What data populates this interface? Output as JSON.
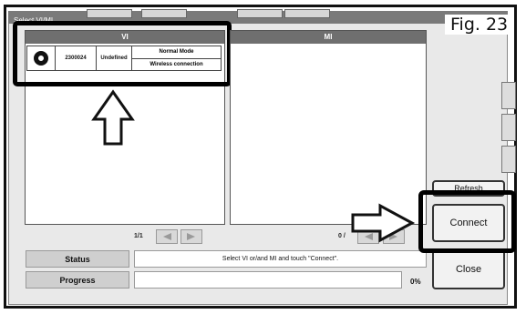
{
  "figure_label": "Fig. 23",
  "window": {
    "title": "Select VI/MI"
  },
  "vi_panel": {
    "header": "VI",
    "device": {
      "serial": "2300024",
      "type": "Undefined",
      "mode": "Normal Mode",
      "connection": "Wireless connection"
    },
    "pager": "1/1"
  },
  "mi_panel": {
    "header": "MI",
    "pager": "0 /"
  },
  "status": {
    "label": "Status",
    "message": "Select VI or/and MI and touch \"Connect\"."
  },
  "progress": {
    "label": "Progress",
    "value_text": "0%"
  },
  "buttons": {
    "refresh": "Refresh",
    "connect": "Connect",
    "close": "Close"
  },
  "icons": {
    "vi_device": "ring-icon",
    "page_prev": "triangle-left-icon",
    "page_next": "triangle-right-icon",
    "callout_up": "outline-arrow-up-icon",
    "callout_right": "outline-arrow-right-icon"
  }
}
